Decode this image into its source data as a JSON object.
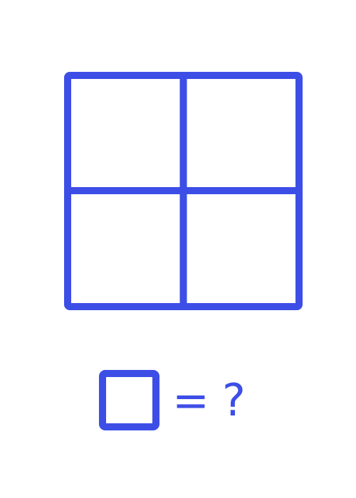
{
  "colors": {
    "stroke": "#3d4ee6",
    "background": "#ffffff"
  },
  "figure": {
    "shape": "square divided into 4 equal squares (2x2 grid)",
    "rows": 2,
    "columns": 2
  },
  "equation": {
    "symbol": "small square",
    "equals": "=",
    "unknown": "?"
  }
}
